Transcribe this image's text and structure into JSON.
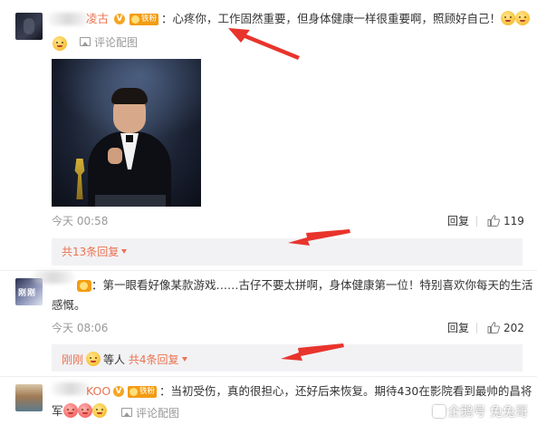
{
  "comments": [
    {
      "username": "凌古",
      "verified_mark": "V",
      "fan_badge": "铁粉",
      "text": "：心疼你，工作固然重要，但身体健康一样很重要啊，照顾好自己！",
      "picture_link": "评论配图",
      "time": "今天 00:58",
      "reply_label": "回复",
      "likes": "119",
      "thread_summary": "共13条回复"
    },
    {
      "text_line1": "：第一眼看好像某款游戏……古仔不要太拼啊，身体健康第一位！特别喜欢你每天的生活",
      "text_line2": "感慨。",
      "avatar_text": "刚刚",
      "time": "今天 08:06",
      "reply_label": "回复",
      "likes": "202",
      "thread_user": "刚刚",
      "thread_mid": "等人",
      "thread_summary": "共4条回复"
    },
    {
      "username": "KOO",
      "verified_mark": "V",
      "fan_badge": "铁粉",
      "text_line1": "：当初受伤，真的很担心，还好后来恢复。期待430在影院看到最帅的昌将",
      "text_line2": "军",
      "picture_link": "评论配图"
    }
  ],
  "watermark": "企鹅号 兔兔哥",
  "colors": {
    "username": "#eb7350",
    "arrow": "#e8342c",
    "reply_box": "#f2f2f5",
    "meta": "#999999"
  },
  "icons": [
    "verified-v-icon",
    "fan-badge-icon",
    "emoji-icon",
    "picture-icon",
    "like-thumb-icon",
    "expand-triangle-icon"
  ]
}
